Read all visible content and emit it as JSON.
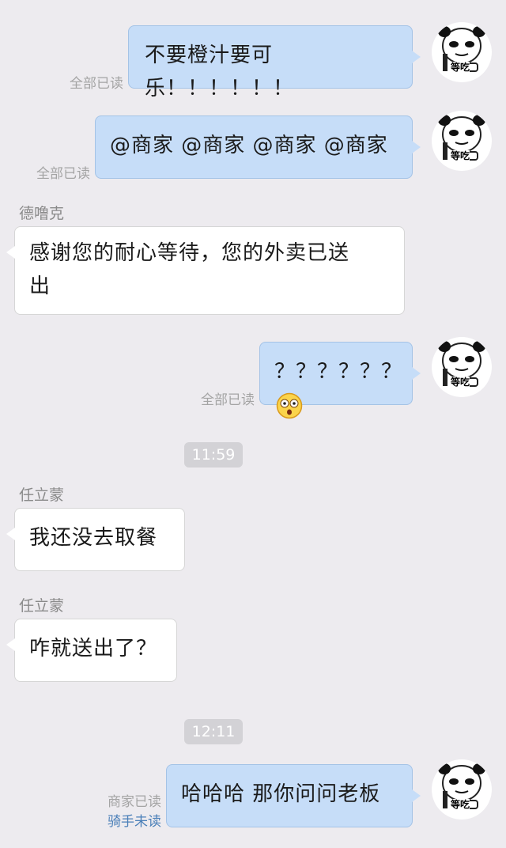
{
  "messages": [
    {
      "type": "out",
      "text": "不要橙汁要可乐！！！！！！",
      "read": "全部已读",
      "avatar_caption": "等吃"
    },
    {
      "type": "out",
      "text": "@商家 @商家 @商家 @商家",
      "read": "全部已读",
      "avatar_caption": "等吃"
    },
    {
      "type": "in",
      "sender": "德噜克",
      "text_line1": "感谢您的耐心等待，您的外卖已送",
      "text_line2": "出"
    },
    {
      "type": "out",
      "text": "？？？？？？",
      "emoji": "astonished-face-icon",
      "read": "全部已读",
      "avatar_caption": "等吃"
    },
    {
      "type": "time",
      "text": "11:59"
    },
    {
      "type": "in",
      "sender": "任立蒙",
      "text": "我还没去取餐"
    },
    {
      "type": "in",
      "sender": "任立蒙",
      "text": "咋就送出了？"
    },
    {
      "type": "time",
      "text": "12:11"
    },
    {
      "type": "out",
      "text": "哈哈哈 那你问问老板",
      "read_merchant": "商家已读",
      "read_rider": "骑手未读",
      "avatar_caption": "等吃"
    }
  ],
  "colors": {
    "background": "#edebef",
    "out_bubble": "#c6ddf8",
    "in_bubble": "#ffffff",
    "rider_unread": "#4a7fb8"
  }
}
